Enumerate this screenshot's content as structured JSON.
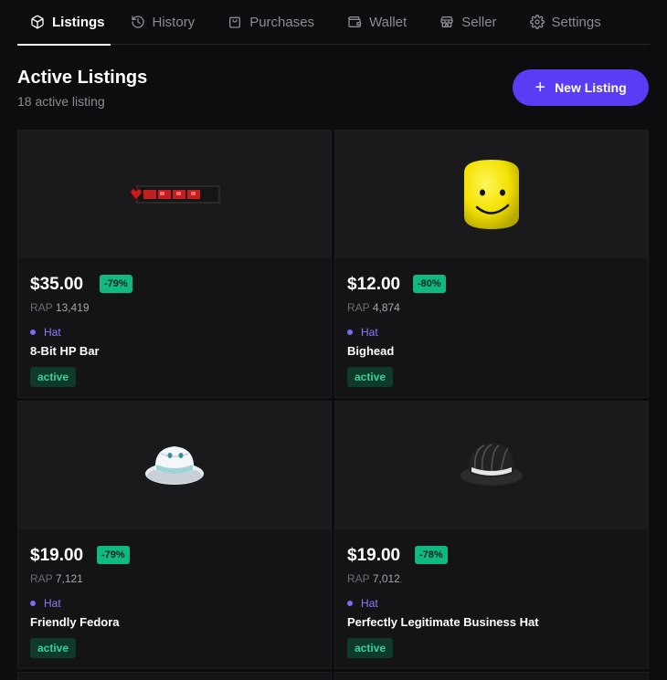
{
  "tabs": [
    {
      "label": "Listings",
      "icon": "package-icon",
      "active": true
    },
    {
      "label": "History",
      "icon": "history-icon",
      "active": false
    },
    {
      "label": "Purchases",
      "icon": "shopping-bag-icon",
      "active": false
    },
    {
      "label": "Wallet",
      "icon": "wallet-icon",
      "active": false
    },
    {
      "label": "Seller",
      "icon": "store-icon",
      "active": false
    },
    {
      "label": "Settings",
      "icon": "gear-icon",
      "active": false
    }
  ],
  "header": {
    "title": "Active Listings",
    "subtitle": "18 active listing",
    "new_listing_label": "New Listing"
  },
  "listings": [
    {
      "price": "$35.00",
      "discount": "-79%",
      "rap_label": "RAP",
      "rap_value": "13,419",
      "type": "Hat",
      "name": "8-Bit HP Bar",
      "status": "active",
      "image": "hp-bar"
    },
    {
      "price": "$12.00",
      "discount": "-80%",
      "rap_label": "RAP",
      "rap_value": "4,874",
      "type": "Hat",
      "name": "Bighead",
      "status": "active",
      "image": "bighead"
    },
    {
      "price": "$19.00",
      "discount": "-79%",
      "rap_label": "RAP",
      "rap_value": "7,121",
      "type": "Hat",
      "name": "Friendly Fedora",
      "status": "active",
      "image": "white-fedora"
    },
    {
      "price": "$19.00",
      "discount": "-78%",
      "rap_label": "RAP",
      "rap_value": "7,012",
      "type": "Hat",
      "name": "Perfectly Legitimate Business Hat",
      "status": "active",
      "image": "black-fedora"
    }
  ],
  "colors": {
    "accent": "#5b3cf5",
    "discount_bg": "#10b981",
    "status_bg": "#0f3a2b",
    "status_text": "#34d399",
    "type_text": "#8b7cf6"
  }
}
